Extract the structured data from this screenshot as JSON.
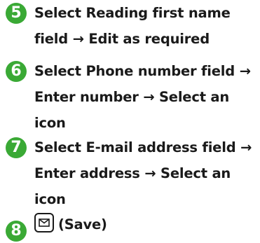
{
  "steps": [
    {
      "number": "5",
      "color": "#3aa935",
      "lines": [
        "Select Reading first name",
        "field → Edit as required"
      ]
    },
    {
      "number": "6",
      "color": "#3aa935",
      "lines": [
        "Select Phone number field →",
        "Enter number → Select an",
        "icon"
      ]
    },
    {
      "number": "7",
      "color": "#3aa935",
      "lines": [
        "Select E-mail address field →",
        "Enter address → Select an",
        "icon"
      ]
    },
    {
      "number": "8",
      "color": "#3aa935",
      "key_icon": "mail-key-icon",
      "lines": [
        "(Save)"
      ]
    }
  ]
}
